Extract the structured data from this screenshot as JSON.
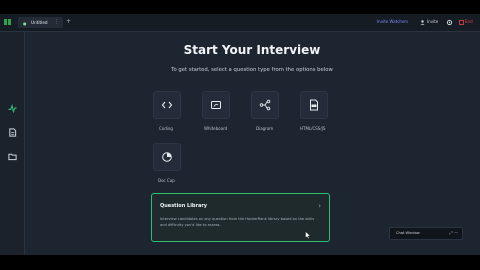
{
  "window": {
    "tab_label": "Untitled",
    "tab_menu": "⋮",
    "new_tab": "+",
    "topbar_link": "Invite Watchers",
    "invite_label": "Invite",
    "end_label": "End",
    "accent": "#2fbf71",
    "danger": "#e5484d",
    "link_color": "#7c8cff"
  },
  "sidebar": {
    "items": [
      {
        "icon": "activity-icon",
        "active": true
      },
      {
        "icon": "document-icon",
        "active": false
      },
      {
        "icon": "folder-icon",
        "active": false
      }
    ]
  },
  "main": {
    "title": "Start Your Interview",
    "subtitle": "To get started, select a question type from the options below"
  },
  "question_types": [
    {
      "label": "Coding",
      "icon": "code-icon"
    },
    {
      "label": "Whiteboard",
      "icon": "whiteboard-icon"
    },
    {
      "label": "Diagram",
      "icon": "diagram-icon"
    },
    {
      "label": "HTML/CSS/JS",
      "icon": "html-file-icon"
    },
    {
      "label": "Doc Cap",
      "icon": "pie-chart-icon"
    }
  ],
  "library": {
    "title": "Question Library",
    "description": "Interview candidates on any question from the HackerRank library based on the skills and difficulty you'd like to assess.",
    "chevron": "›"
  },
  "chat_widget": {
    "label": "Chat Window",
    "icons": "⤢ —"
  }
}
